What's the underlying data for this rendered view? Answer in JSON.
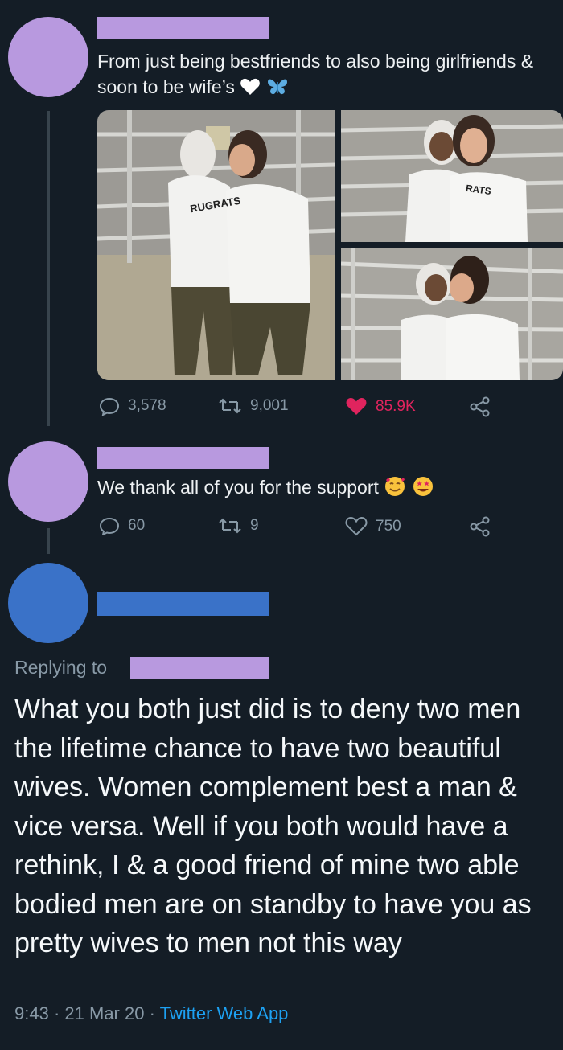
{
  "colors": {
    "background": "#141d26",
    "redaction_purple": "#b899df",
    "redaction_blue": "#3a72c8",
    "avatar_purple": "#b899df",
    "avatar_blue": "#3a72c8",
    "like_active": "#e0245e",
    "secondary_text": "#8899a6",
    "link": "#1da1f2"
  },
  "tweet1": {
    "text": "From just being bestfriends to also being girlfriends & soon to be wife’s",
    "emojis": [
      "white-heart-icon",
      "butterfly-icon"
    ],
    "shirt_text_left": "RUGRATS",
    "shirt_text_right": "RATS",
    "replies": "3,578",
    "retweets": "9,001",
    "likes": "85.9K",
    "liked": true
  },
  "tweet2": {
    "text": "We thank all of you for the support",
    "emojis": [
      "smiling-face-with-hearts-icon",
      "star-struck-icon"
    ],
    "replies": "60",
    "retweets": "9",
    "likes": "750"
  },
  "reply": {
    "replying_to_label": "Replying to",
    "text": "What you both just did is to deny two men the lifetime chance to have two beautiful wives. Women complement best a man & vice versa. Well if you both would have a rethink, I & a good friend of mine two able bodied men are on standby to have you as pretty wives to men not this way",
    "time": "9:43",
    "date": "21 Mar 20",
    "separator": "·",
    "source": "Twitter Web App"
  }
}
